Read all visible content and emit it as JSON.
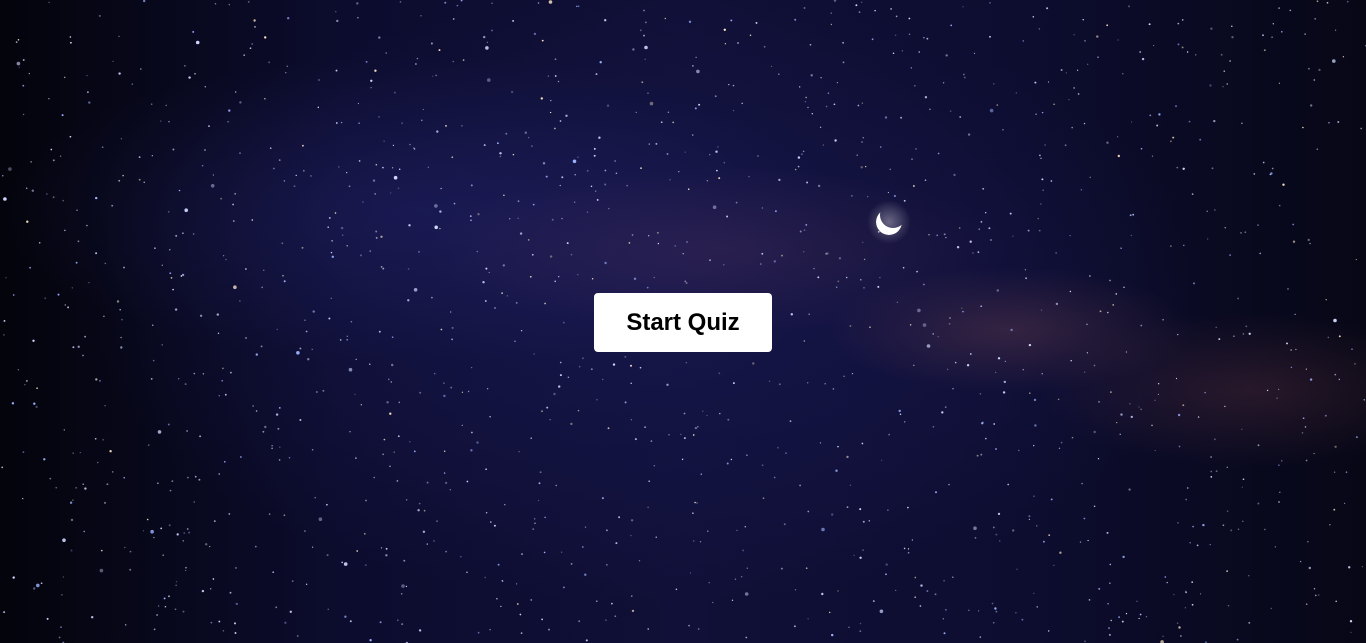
{
  "quiz": {
    "start_label": "Start Quiz"
  },
  "background": {
    "scene": "night-sky-with-milky-way",
    "icon": "crescent-moon-icon",
    "colors": {
      "sky": "#0d0d30",
      "button": "#ffffff",
      "button_text": "#000000"
    }
  }
}
